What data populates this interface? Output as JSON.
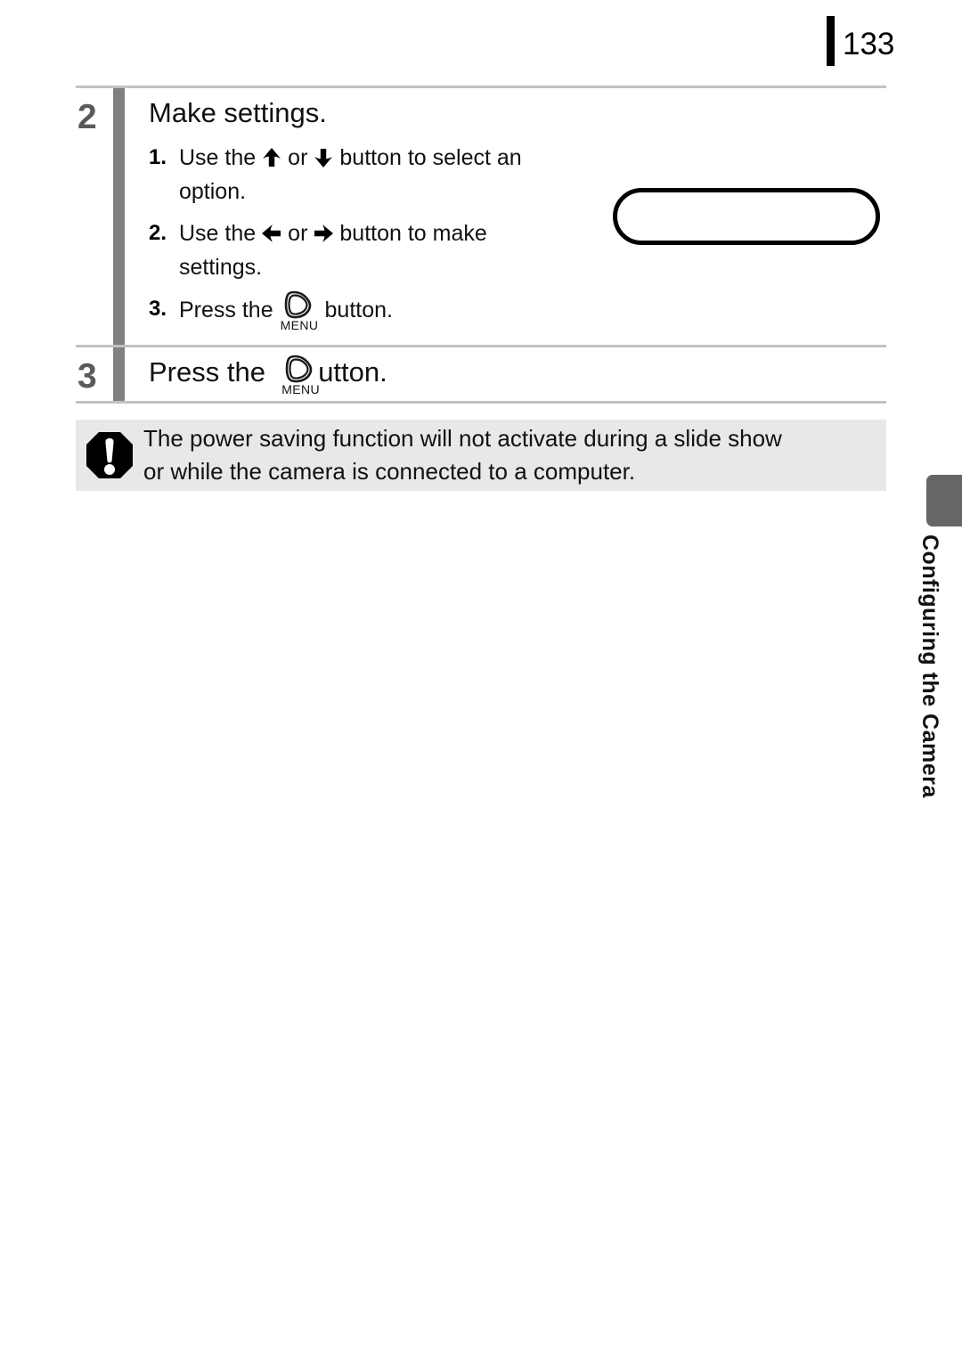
{
  "page": {
    "number": "133"
  },
  "steps": [
    {
      "number": "2",
      "title": "Make settings.",
      "substeps": [
        {
          "number": "1.",
          "line1_pre": "Use the",
          "icon1": "arrow-up-icon",
          "mid": "or",
          "icon2": "arrow-down-icon",
          "line1_post": "button to select an",
          "line2": "option."
        },
        {
          "number": "2.",
          "line1_pre": "Use the",
          "icon1": "arrow-left-icon",
          "mid": "or",
          "icon2": "arrow-right-icon",
          "line1_post": "button to make",
          "line2": "settings."
        },
        {
          "number": "3.",
          "line1_pre": "Press the",
          "icon1": "menu-button-icon",
          "icon_label": "MENU",
          "line1_post": "button."
        }
      ]
    },
    {
      "number": "3",
      "title_pre": "Press the",
      "icon": "menu-button-icon",
      "icon_label": "MENU",
      "title_post": "utton."
    }
  ],
  "note": {
    "icon": "caution-exclamation-icon",
    "line1": "The power saving function will not activate during a slide show",
    "line2": "or while the camera is connected to a computer."
  },
  "side_tab": {
    "label": "Configuring the Camera"
  },
  "colors": {
    "step_number": "#5a5a5a",
    "step_bar": "#808080",
    "rule": "#c2c2c2",
    "note_background": "#e8e8e8",
    "side_tab": "#666666",
    "text": "#111111"
  }
}
